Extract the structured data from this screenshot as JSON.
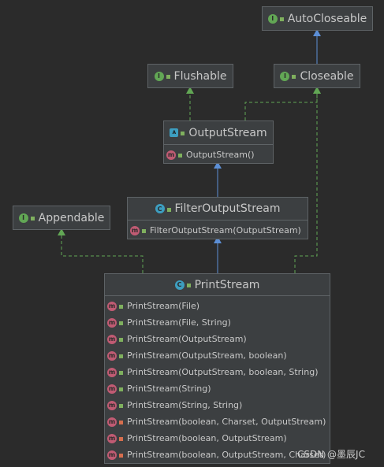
{
  "diagram": {
    "nodes": [
      {
        "id": "autocloseable",
        "kind": "interface",
        "icon": "interface-icon",
        "visibility": "public",
        "name": "AutoCloseable",
        "members": []
      },
      {
        "id": "flushable",
        "kind": "interface",
        "icon": "interface-icon",
        "visibility": "public",
        "name": "Flushable",
        "members": []
      },
      {
        "id": "closeable",
        "kind": "interface",
        "icon": "interface-icon",
        "visibility": "public",
        "name": "Closeable",
        "members": []
      },
      {
        "id": "outputstream",
        "kind": "abstract-class",
        "icon": "abstract-class-icon",
        "visibility": "public",
        "name": "OutputStream",
        "members": [
          {
            "text": "OutputStream()",
            "visibility": "public"
          }
        ]
      },
      {
        "id": "filteroutputstream",
        "kind": "class",
        "icon": "class-icon",
        "visibility": "public",
        "name": "FilterOutputStream",
        "members": [
          {
            "text": "FilterOutputStream(OutputStream)",
            "visibility": "public"
          }
        ]
      },
      {
        "id": "appendable",
        "kind": "interface",
        "icon": "interface-icon",
        "visibility": "public",
        "name": "Appendable",
        "members": []
      },
      {
        "id": "printstream",
        "kind": "class",
        "icon": "class-icon",
        "visibility": "public",
        "name": "PrintStream",
        "members": [
          {
            "text": "PrintStream(File)",
            "visibility": "public"
          },
          {
            "text": "PrintStream(File, String)",
            "visibility": "public"
          },
          {
            "text": "PrintStream(OutputStream)",
            "visibility": "public"
          },
          {
            "text": "PrintStream(OutputStream, boolean)",
            "visibility": "public"
          },
          {
            "text": "PrintStream(OutputStream, boolean, String)",
            "visibility": "public"
          },
          {
            "text": "PrintStream(String)",
            "visibility": "public"
          },
          {
            "text": "PrintStream(String, String)",
            "visibility": "public"
          },
          {
            "text": "PrintStream(boolean, Charset, OutputStream)",
            "visibility": "private"
          },
          {
            "text": "PrintStream(boolean, OutputStream)",
            "visibility": "private"
          },
          {
            "text": "PrintStream(boolean, OutputStream, Charset)",
            "visibility": "private"
          }
        ]
      }
    ],
    "edges": [
      {
        "from": "closeable",
        "to": "autocloseable",
        "relation": "extends"
      },
      {
        "from": "outputstream",
        "to": "flushable",
        "relation": "implements"
      },
      {
        "from": "outputstream",
        "to": "closeable",
        "relation": "implements"
      },
      {
        "from": "filteroutputstream",
        "to": "outputstream",
        "relation": "extends"
      },
      {
        "from": "printstream",
        "to": "filteroutputstream",
        "relation": "extends"
      },
      {
        "from": "printstream",
        "to": "appendable",
        "relation": "implements"
      },
      {
        "from": "printstream",
        "to": "closeable",
        "relation": "implements"
      }
    ]
  },
  "colors": {
    "background": "#2b2b2b",
    "box": "#3c3f41",
    "extends_edge": "#5c8fd6",
    "implements_edge": "#62a755",
    "interface_icon": "#62a755",
    "class_icon": "#3d9ec0",
    "method_icon": "#c05b73"
  },
  "watermark": "CSDN @墨辰JC"
}
